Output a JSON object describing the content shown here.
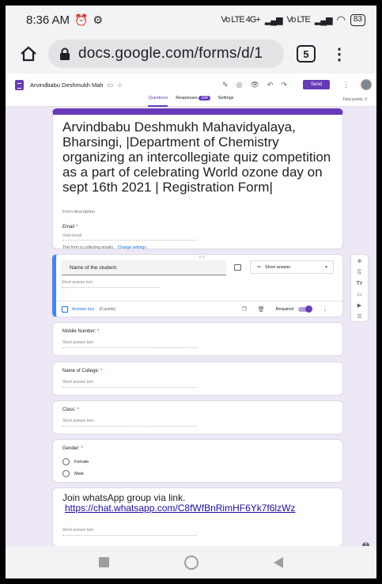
{
  "status_bar": {
    "time": "8:36 AM",
    "alarm_icon": "alarm-icon",
    "settings_icon": "gear-icon",
    "network_1": "Vo LTE 4G+",
    "network_2": "Vo LTE",
    "battery": "83"
  },
  "browser": {
    "url": "docs.google.com/forms/d/1",
    "tab_count": "5",
    "menu_glyph": "⋮"
  },
  "forms_header": {
    "doc_title": "Arvindbabu Deshmukh Mah",
    "send_label": "Send",
    "tabs": [
      {
        "label": "Questions",
        "active": true
      },
      {
        "label": "Responses",
        "badge": "164"
      },
      {
        "label": "Settings"
      }
    ],
    "total_points": "Total points: 0"
  },
  "form": {
    "title": "Arvindbabu Deshmukh Mahavidyalaya, Bharsingi, |Department of Chemistry organizing an intercollegiate quiz competition as a part of celebrating World ozone day on sept 16th 2021 | Registration Form|",
    "description_placeholder": "Form description",
    "email_label": "Email",
    "required_mark": "*",
    "email_placeholder": "Valid email",
    "collecting_text": "This form is collecting emails.",
    "change_settings": "Change settings"
  },
  "active_question": {
    "title": "Name of the student:",
    "type": "Short answer",
    "answer_placeholder": "Short answer text",
    "answer_key": "Answer key",
    "points": "(0 points)",
    "required_label": "Required",
    "required_on": true
  },
  "questions": [
    {
      "label": "Mobile Number:",
      "required": true,
      "placeholder": "Short answer text"
    },
    {
      "label": "Name of College:",
      "required": true,
      "placeholder": "Short answer text"
    },
    {
      "label": "Class:",
      "required": true,
      "placeholder": "Short answer text"
    }
  ],
  "gender_question": {
    "label": "Gender:",
    "options": [
      "Female",
      "Male"
    ]
  },
  "whatsapp_section": {
    "title": "Join whatsApp group via link.",
    "link": "https://chat.whatsapp.com/C8fWfBnRimHF6Yk7f6lzWz",
    "placeholder": "Short answer text"
  },
  "accent_color": "#673ab7"
}
